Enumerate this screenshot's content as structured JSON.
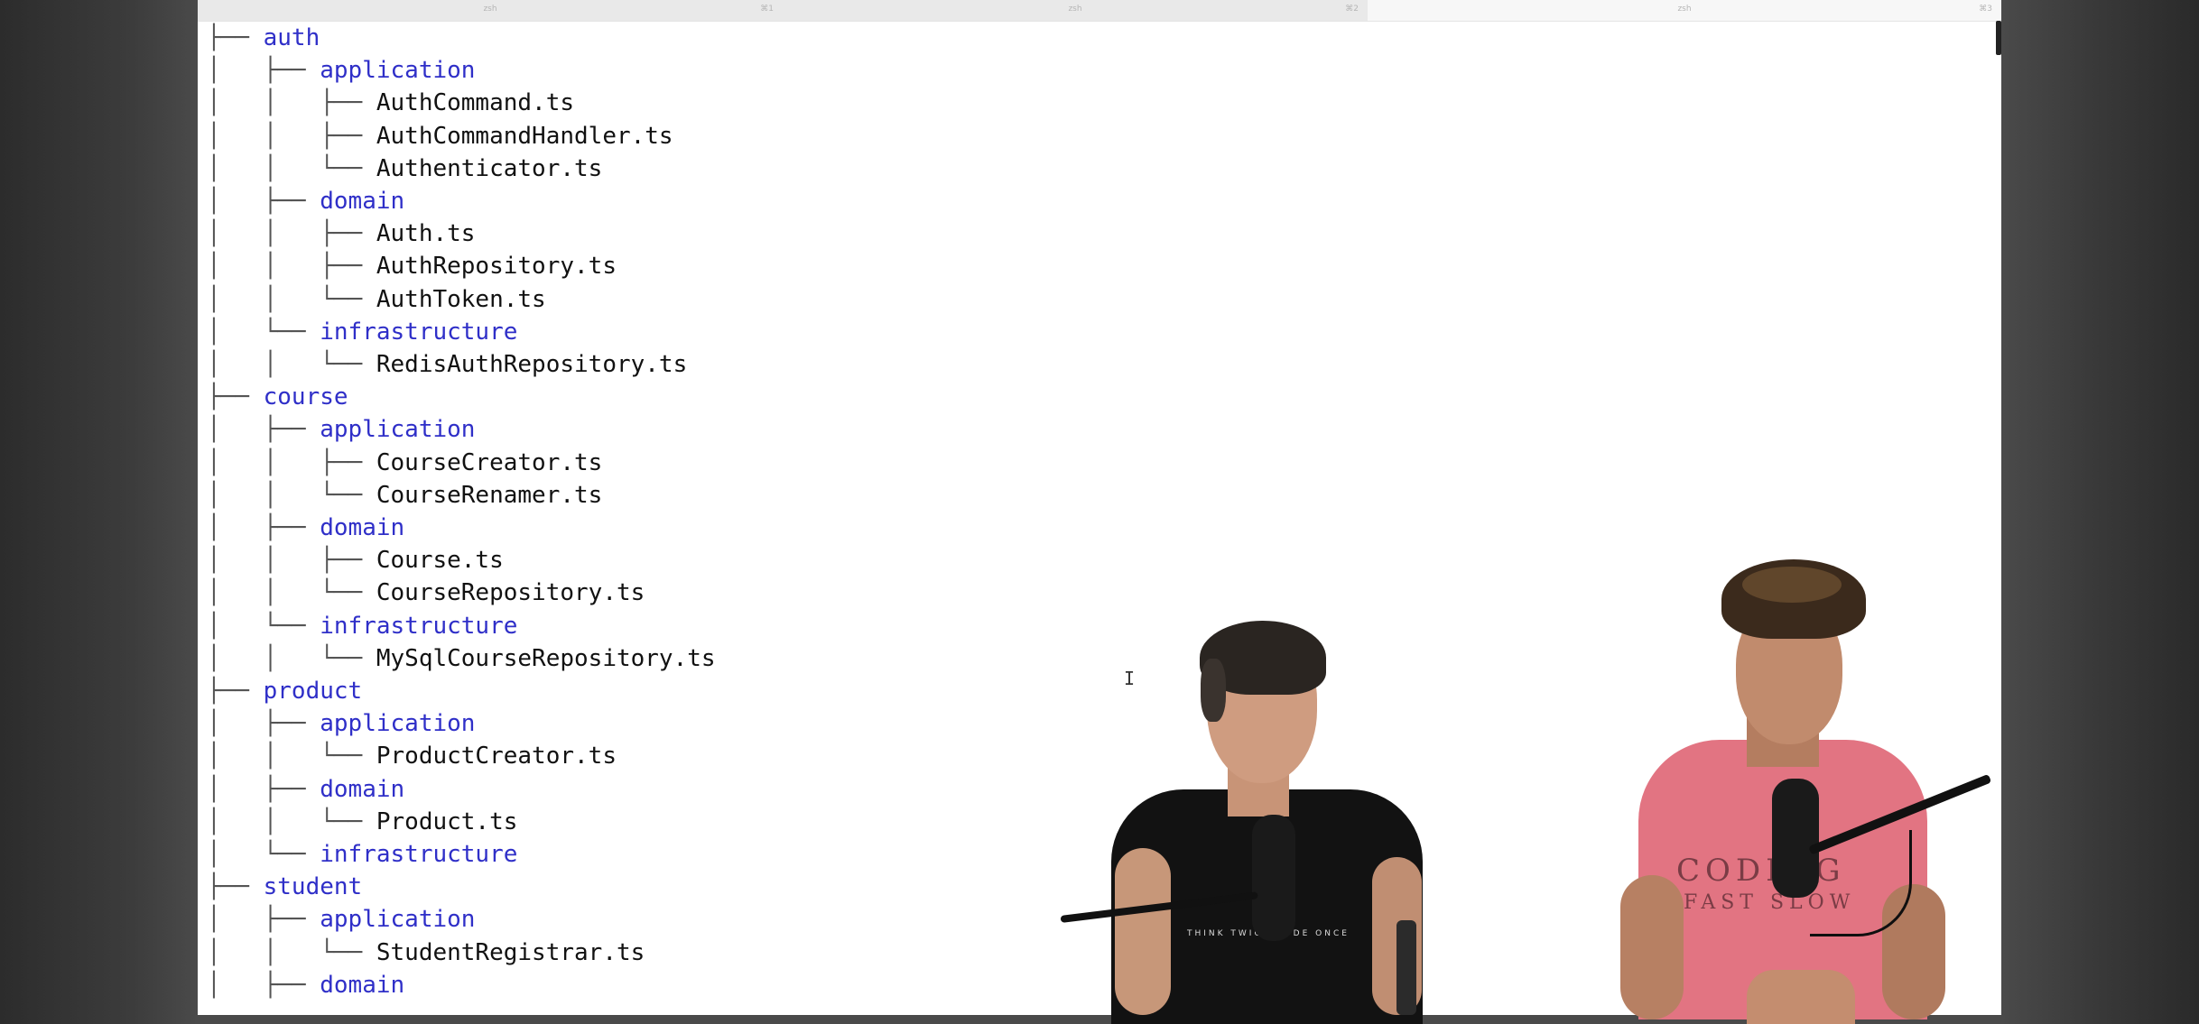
{
  "terminal": {
    "tabs": [
      {
        "label": "zsh",
        "shortcut": "⌘1"
      },
      {
        "label": "zsh",
        "shortcut": "⌘2"
      },
      {
        "label": "zsh",
        "shortcut": "⌘3"
      }
    ],
    "tree": [
      {
        "depth": 0,
        "connector": "├──",
        "name": "auth",
        "type": "dir"
      },
      {
        "depth": 1,
        "connector": "├──",
        "name": "application",
        "type": "dir"
      },
      {
        "depth": 2,
        "connector": "├──",
        "name": "AuthCommand.ts",
        "type": "file"
      },
      {
        "depth": 2,
        "connector": "├──",
        "name": "AuthCommandHandler.ts",
        "type": "file"
      },
      {
        "depth": 2,
        "connector": "└──",
        "name": "Authenticator.ts",
        "type": "file"
      },
      {
        "depth": 1,
        "connector": "├──",
        "name": "domain",
        "type": "dir"
      },
      {
        "depth": 2,
        "connector": "├──",
        "name": "Auth.ts",
        "type": "file"
      },
      {
        "depth": 2,
        "connector": "├──",
        "name": "AuthRepository.ts",
        "type": "file"
      },
      {
        "depth": 2,
        "connector": "└──",
        "name": "AuthToken.ts",
        "type": "file"
      },
      {
        "depth": 1,
        "connector": "└──",
        "name": "infrastructure",
        "type": "dir"
      },
      {
        "depth": 2,
        "connector": "└──",
        "name": "RedisAuthRepository.ts",
        "type": "file"
      },
      {
        "depth": 0,
        "connector": "├──",
        "name": "course",
        "type": "dir"
      },
      {
        "depth": 1,
        "connector": "├──",
        "name": "application",
        "type": "dir"
      },
      {
        "depth": 2,
        "connector": "├──",
        "name": "CourseCreator.ts",
        "type": "file"
      },
      {
        "depth": 2,
        "connector": "└──",
        "name": "CourseRenamer.ts",
        "type": "file"
      },
      {
        "depth": 1,
        "connector": "├──",
        "name": "domain",
        "type": "dir"
      },
      {
        "depth": 2,
        "connector": "├──",
        "name": "Course.ts",
        "type": "file"
      },
      {
        "depth": 2,
        "connector": "└──",
        "name": "CourseRepository.ts",
        "type": "file"
      },
      {
        "depth": 1,
        "connector": "└──",
        "name": "infrastructure",
        "type": "dir"
      },
      {
        "depth": 2,
        "connector": "└──",
        "name": "MySqlCourseRepository.ts",
        "type": "file"
      },
      {
        "depth": 0,
        "connector": "├──",
        "name": "product",
        "type": "dir"
      },
      {
        "depth": 1,
        "connector": "├──",
        "name": "application",
        "type": "dir"
      },
      {
        "depth": 2,
        "connector": "└──",
        "name": "ProductCreator.ts",
        "type": "file"
      },
      {
        "depth": 1,
        "connector": "├──",
        "name": "domain",
        "type": "dir"
      },
      {
        "depth": 2,
        "connector": "└──",
        "name": "Product.ts",
        "type": "file"
      },
      {
        "depth": 1,
        "connector": "└──",
        "name": "infrastructure",
        "type": "dir"
      },
      {
        "depth": 0,
        "connector": "├──",
        "name": "student",
        "type": "dir"
      },
      {
        "depth": 1,
        "connector": "├──",
        "name": "application",
        "type": "dir"
      },
      {
        "depth": 2,
        "connector": "└──",
        "name": "StudentRegistrar.ts",
        "type": "file"
      },
      {
        "depth": 1,
        "connector": "├──",
        "name": "domain",
        "type": "dir"
      }
    ]
  },
  "webcam": {
    "shirt_text_1": "CODING",
    "shirt_text_2": "FAST SLOW",
    "shirt_text_small": "THINK TWICE CODE ONCE"
  },
  "colors": {
    "directory": "#2f2fc8",
    "file": "#111111",
    "pink_shirt": "#e27482",
    "black_shirt": "#121212"
  }
}
